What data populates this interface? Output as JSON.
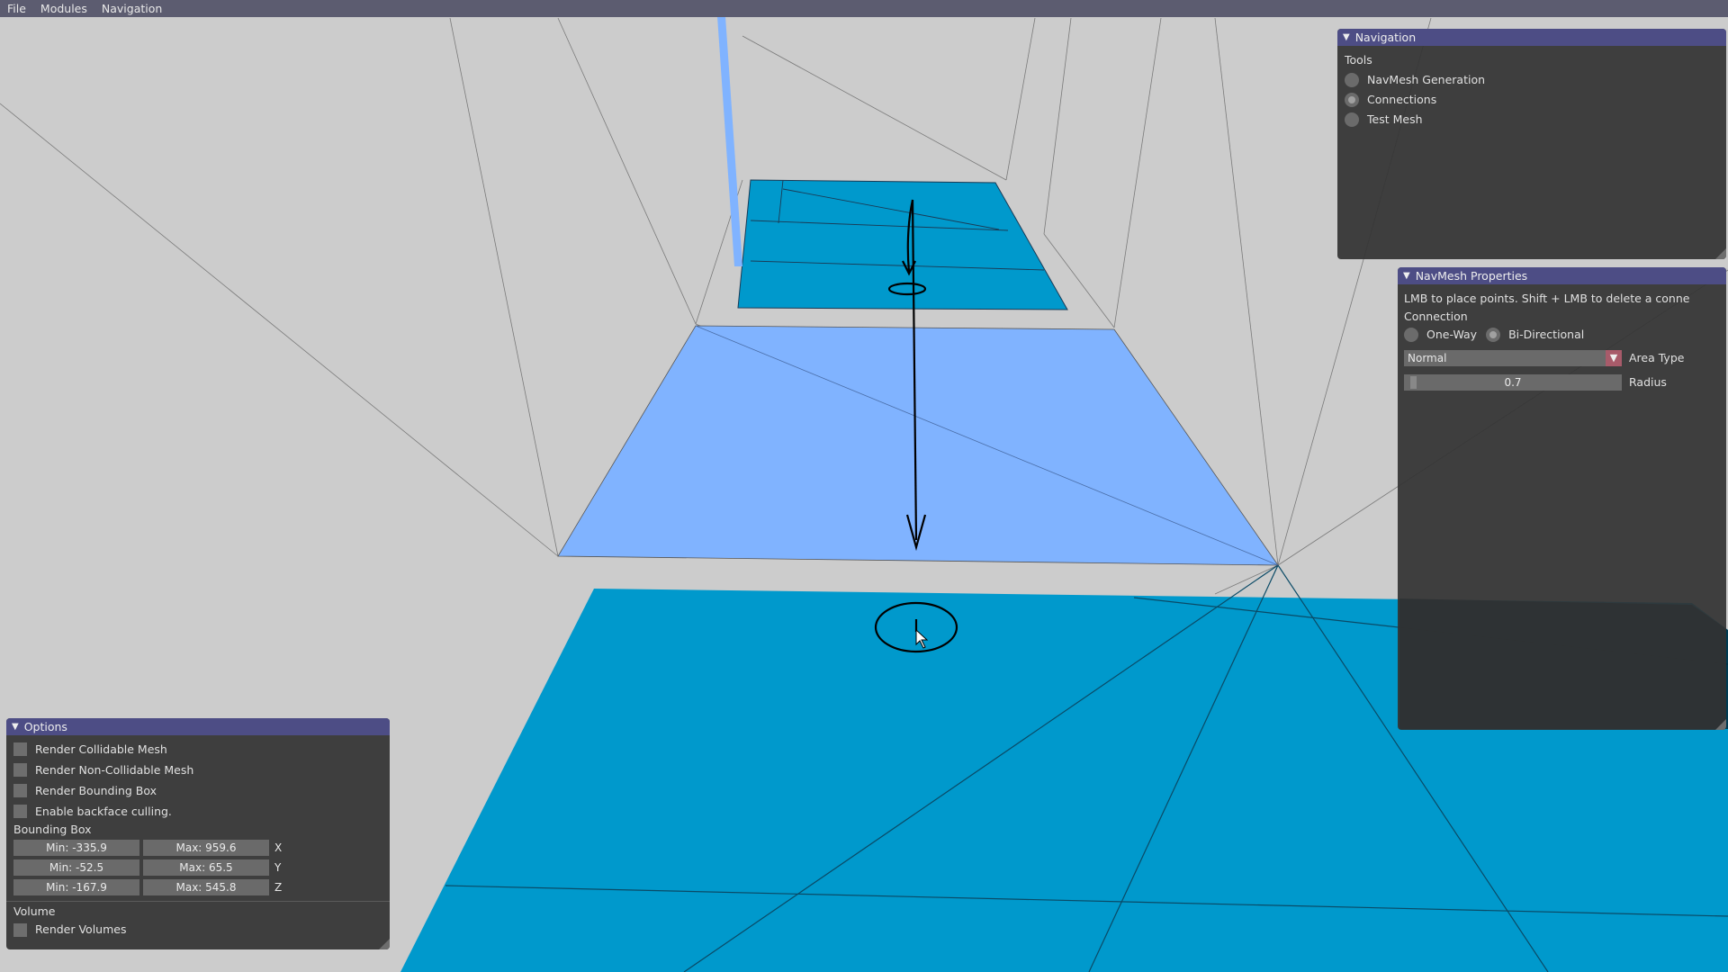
{
  "menubar": {
    "items": [
      "File",
      "Modules",
      "Navigation"
    ]
  },
  "navigation_window": {
    "title": "Navigation",
    "tools_label": "Tools",
    "tools": [
      {
        "label": "NavMesh Generation",
        "selected": false
      },
      {
        "label": "Connections",
        "selected": true
      },
      {
        "label": "Test Mesh",
        "selected": false
      }
    ]
  },
  "properties_window": {
    "title": "NavMesh Properties",
    "hint": "LMB to place points. Shift + LMB to delete a conne",
    "connection_label": "Connection",
    "one_way_label": "One-Way",
    "bi_directional_label": "Bi-Directional",
    "area_type_value": "Normal",
    "area_type_label": "Area Type",
    "radius_value": "0.7",
    "radius_label": "Radius"
  },
  "options_window": {
    "title": "Options",
    "checkboxes": [
      {
        "label": "Render Collidable Mesh",
        "checked": false
      },
      {
        "label": "Render Non-Collidable Mesh",
        "checked": false
      },
      {
        "label": "Render Bounding Box",
        "checked": false
      },
      {
        "label": "Enable backface culling.",
        "checked": false
      }
    ],
    "bounding_box_label": "Bounding Box",
    "bounds": [
      {
        "min": "Min: -335.9",
        "max": "Max: 959.6",
        "axis": "X"
      },
      {
        "min": "Min: -52.5",
        "max": "Max: 65.5",
        "axis": "Y"
      },
      {
        "min": "Min: -167.9",
        "max": "Max: 545.8",
        "axis": "Z"
      }
    ],
    "volume_label": "Volume",
    "render_volumes_label": "Render Volumes"
  },
  "colors": {
    "background": "#cccccc",
    "navmesh_dark": "#0099cc",
    "navmesh_light": "#80b3ff",
    "panel": "#333333",
    "titlebar": "#4d4d85",
    "menubar": "#5c5c70"
  }
}
